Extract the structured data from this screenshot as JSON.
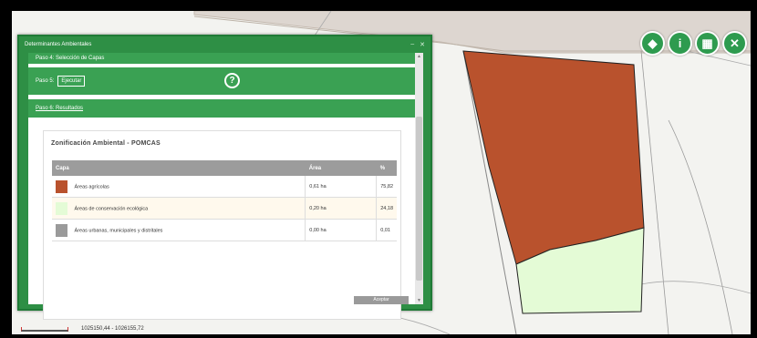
{
  "panel": {
    "title": "Determinantes Ambientales",
    "controls": [
      "–",
      "✕"
    ]
  },
  "steps": {
    "step1_label": "Paso 4: Selección de Capas",
    "step5_label": "Paso 5:",
    "run_button": "Ejecutar",
    "help_glyph": "?",
    "step6_label": "Paso 6: Resultados"
  },
  "results": {
    "title": "Zonificación Ambiental - POMCAS",
    "headers": [
      "Capa",
      "Área",
      "%"
    ],
    "rows": [
      {
        "layer": "Áreas agrícolas",
        "area": "0,61 ha",
        "pct": "75,82",
        "color": "#b9522d"
      },
      {
        "layer": "Áreas de conservación ecológica",
        "area": "0,20 ha",
        "pct": "24,18",
        "color": "#e4fbd6"
      },
      {
        "layer": "Áreas urbanas, municipales y distritales",
        "area": "0,00 ha",
        "pct": "0,01",
        "color": "#9a9a9a"
      }
    ],
    "footer_button": "Aceptar"
  },
  "toolbar": {
    "icons": [
      "layers-icon",
      "info-icon",
      "basemap-icon",
      "tools-icon"
    ],
    "glyphs": [
      "◆",
      "i",
      "▦",
      "✕"
    ]
  },
  "statusbar": {
    "coordinates": "1025150,44 - 1026155,72"
  },
  "colors": {
    "panel_green": "#2e8f45",
    "step_green": "#3aa153",
    "agri_fill": "#b9522d",
    "conservation_fill": "#e4fbd6"
  }
}
